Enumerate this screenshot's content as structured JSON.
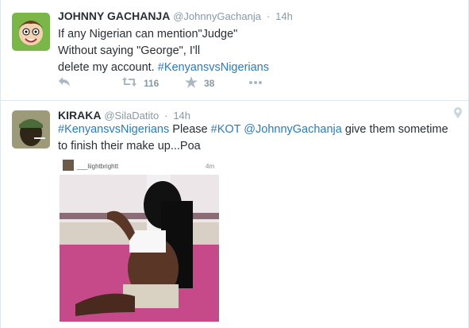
{
  "tweets": [
    {
      "fullname": "JOHNNY GACHANJA",
      "handle": "@JohnnyGachanja",
      "time": "14h",
      "lines": [
        "If any Nigerian can mention\"Judge\"",
        "Without saying \"George\", I'll"
      ],
      "line3_prefix": "delete my account. ",
      "line3_tag": "#KenyansvsNigerians",
      "retweets": "116",
      "favorites": "38",
      "icons": [
        "reply-icon",
        "retweet-icon",
        "favorite-icon",
        "more-icon"
      ]
    },
    {
      "fullname": "KIRAKA",
      "handle": "@SilaDatito",
      "time": "14h",
      "tag1": "#KenyansvsNigerians",
      "text1": " Please ",
      "tag2": "#KOT",
      "text2": " ",
      "tag3": "@JohnnyGachanja",
      "text3": " give them sometime",
      "line2": "to finish their make up...Poa",
      "icons": [
        "location-pin-icon"
      ],
      "media": {
        "username": "___liightbrightt",
        "time": "4m"
      }
    }
  ],
  "colors": {
    "link": "#2b7bb9",
    "muted": "#8899a6",
    "text": "#292f33",
    "border": "#e1e8ed"
  }
}
